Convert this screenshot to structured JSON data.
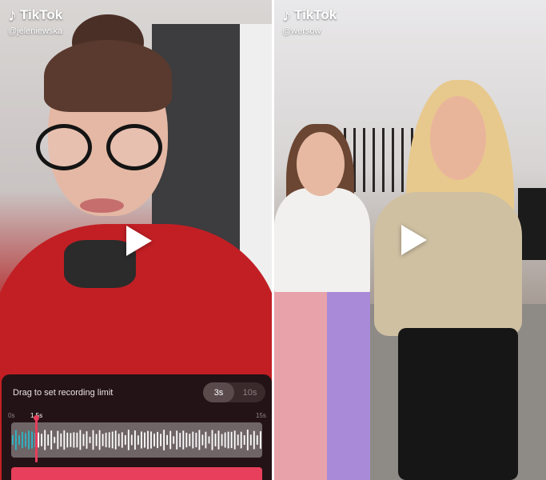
{
  "left_video": {
    "brand": "TikTok",
    "handle": "@jeleniewska",
    "logo_icon": "tiktok-note-icon",
    "play_icon": "play-icon"
  },
  "right_video": {
    "brand": "TikTok",
    "handle": "@wersow",
    "logo_icon": "tiktok-note-icon",
    "play_icon": "play-icon"
  },
  "recording_sheet": {
    "title": "Drag to set recording limit",
    "options": [
      "3s",
      "10s"
    ],
    "selected": "3s",
    "timeline": {
      "start_label": "0s",
      "current_label": "1.5s",
      "end_label": "15s",
      "current_fraction": 0.1
    },
    "accent_color": "#e8405c",
    "played_color": "#2bb6c9"
  }
}
